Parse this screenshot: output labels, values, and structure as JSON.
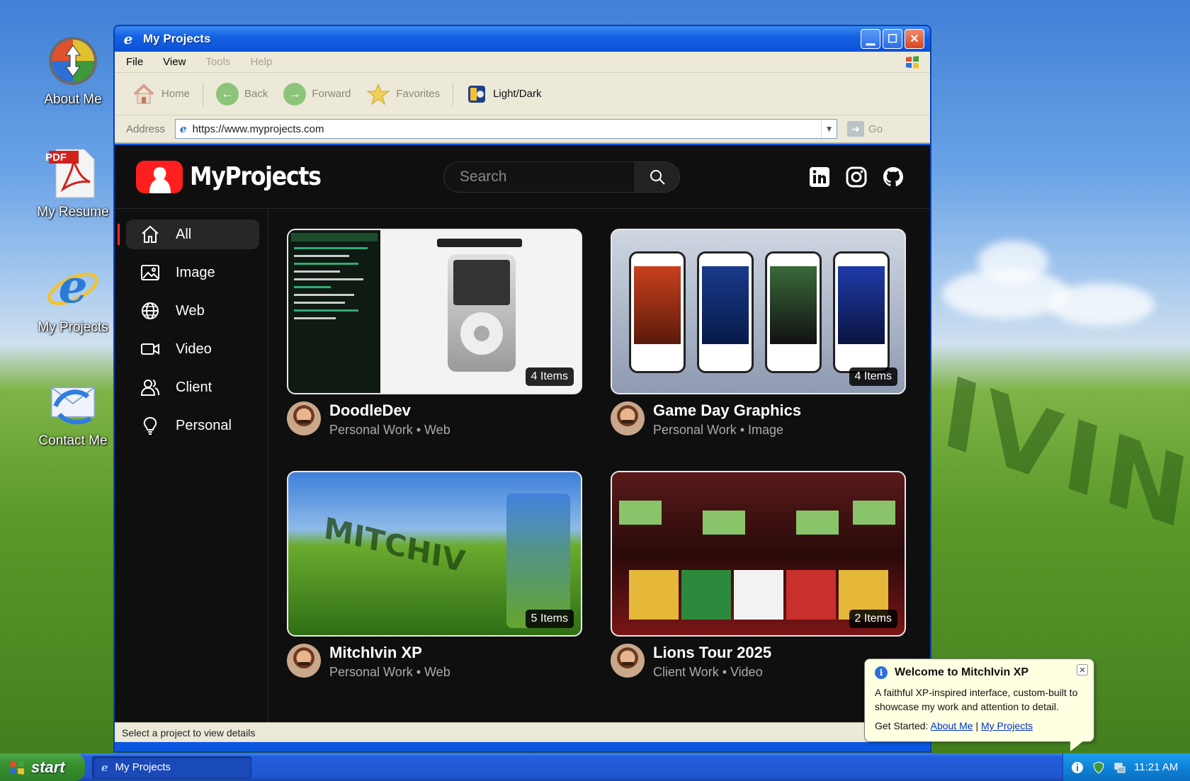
{
  "desktop": {
    "icons": [
      {
        "label": "About Me",
        "icon": "about-me-icon"
      },
      {
        "label": "My Resume",
        "icon": "pdf-icon",
        "badge": "PDF"
      },
      {
        "label": "My Projects",
        "icon": "internet-explorer-icon"
      },
      {
        "label": "Contact Me",
        "icon": "outlook-express-icon"
      }
    ]
  },
  "window": {
    "title": "My Projects",
    "menu": {
      "file": "File",
      "view": "View",
      "tools": "Tools",
      "help": "Help"
    },
    "toolbar": {
      "home": "Home",
      "back": "Back",
      "forward": "Forward",
      "favorites": "Favorites",
      "light_dark": "Light/Dark"
    },
    "address": {
      "label": "Address",
      "url": "https://www.myprojects.com",
      "go": "Go"
    },
    "status_text": "Select a project to view details"
  },
  "site": {
    "brand": "MyProjects",
    "search_placeholder": "Search",
    "socials": [
      "linkedin-icon",
      "instagram-icon",
      "github-icon"
    ],
    "sidebar": [
      {
        "label": "All",
        "icon": "home-icon",
        "active": true
      },
      {
        "label": "Image",
        "icon": "image-icon",
        "active": false
      },
      {
        "label": "Web",
        "icon": "globe-icon",
        "active": false
      },
      {
        "label": "Video",
        "icon": "video-camera-icon",
        "active": false
      },
      {
        "label": "Client",
        "icon": "users-icon",
        "active": false
      },
      {
        "label": "Personal",
        "icon": "lightbulb-icon",
        "active": false
      }
    ],
    "projects": [
      {
        "title": "DoodleDev",
        "subtitle": "Personal Work • Web",
        "items": "4 Items"
      },
      {
        "title": "Game Day Graphics",
        "subtitle": "Personal Work • Image",
        "items": "4 Items"
      },
      {
        "title": "MitchIvin XP",
        "subtitle": "Personal Work • Web",
        "items": "5 Items"
      },
      {
        "title": "Lions Tour 2025",
        "subtitle": "Client Work • Video",
        "items": "2 Items"
      }
    ]
  },
  "balloon": {
    "title": "Welcome to MitchIvin XP",
    "body": "A faithful XP-inspired interface, custom-built to showcase my work and attention to detail.",
    "prefix": "Get Started:",
    "link1": "About Me",
    "separator": "|",
    "link2": "My Projects"
  },
  "taskbar": {
    "start": "start",
    "task_item": "My Projects",
    "clock": "11:21 AM"
  },
  "colors": {
    "accent": "#ff1f1f",
    "xp_blue": "#0b57e0",
    "start_green": "#37922f"
  }
}
